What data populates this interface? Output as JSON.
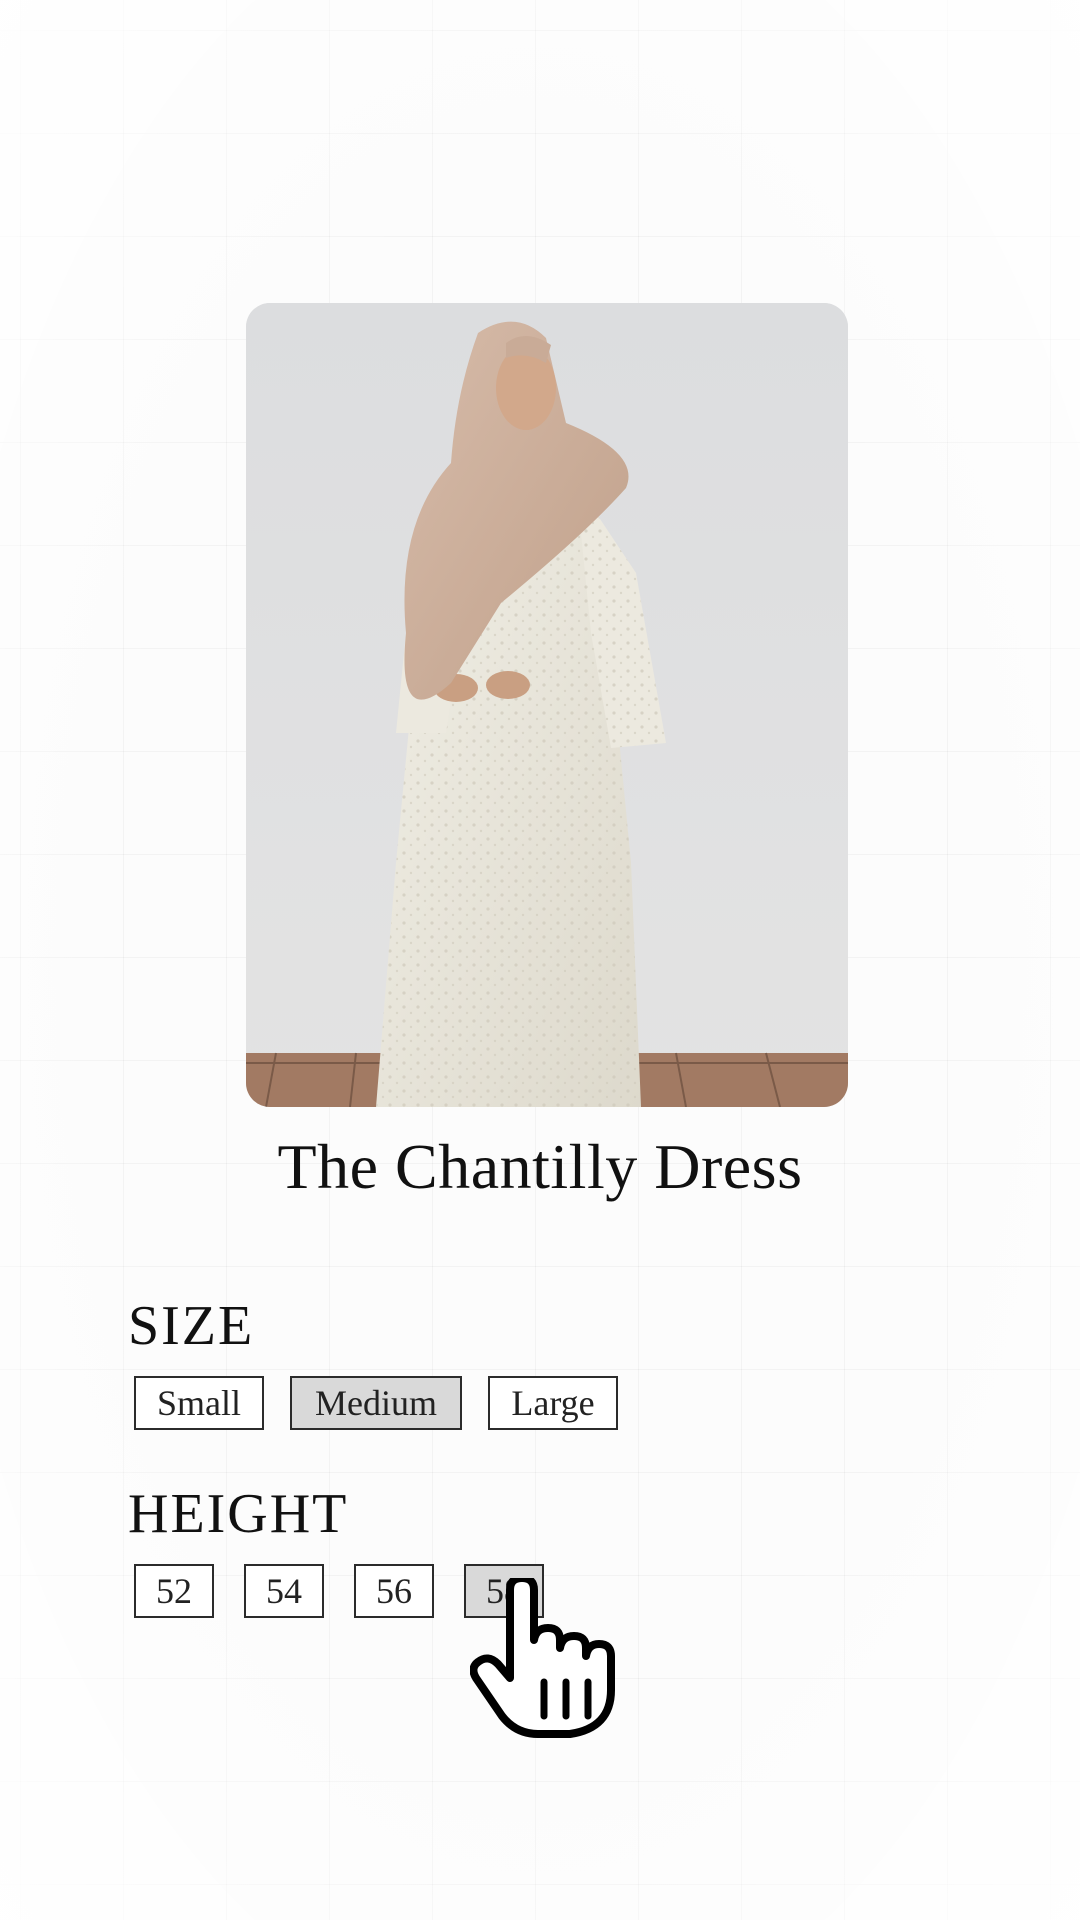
{
  "product": {
    "title": "The Chantilly Dress",
    "image_alt": "Model wearing a cream lace maxi dress with a beige hijab"
  },
  "size": {
    "label": "SIZE",
    "options": [
      "Small",
      "Medium",
      "Large"
    ],
    "selected": "Medium"
  },
  "height": {
    "label": "HEIGHT",
    "options": [
      "52",
      "54",
      "56",
      "58"
    ],
    "selected": "58"
  },
  "colors": {
    "selected_bg": "#d9d9d9",
    "border": "#2b2b2b",
    "text": "#111111"
  },
  "cursor": {
    "icon": "hand-pointer-icon"
  }
}
